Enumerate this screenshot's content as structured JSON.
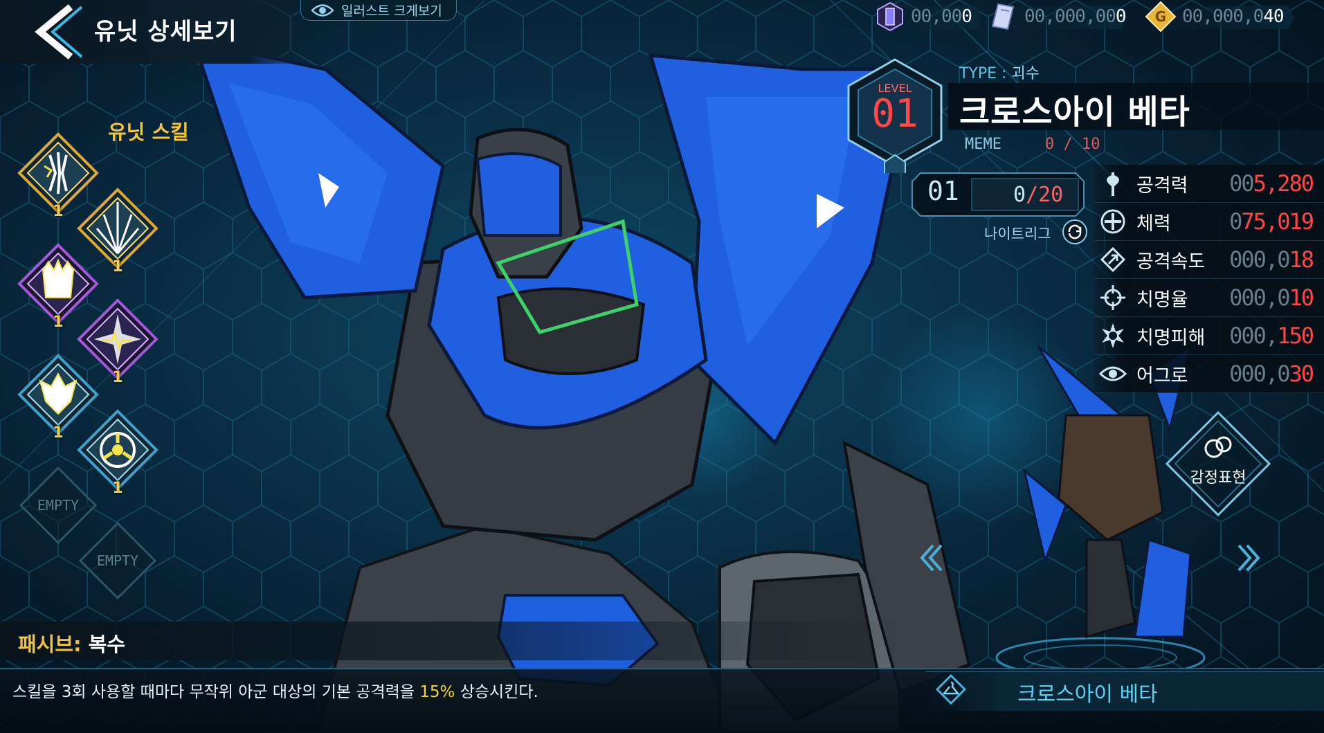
{
  "header": {
    "title": "유닛 상세보기",
    "illust_button": "일러스트 크게보기"
  },
  "currencies": [
    {
      "icon": "gem-crystal-icon",
      "dim": "00,00",
      "value": "0"
    },
    {
      "icon": "ticket-icon",
      "dim": "00,000,00",
      "value": "0"
    },
    {
      "icon": "gold-coin-icon",
      "dim": "00,000,0",
      "value": "40"
    }
  ],
  "skills": {
    "title": "유닛 스킬",
    "items": [
      {
        "icon": "lightning-claw-icon",
        "level": "1"
      },
      {
        "icon": "spike-burst-icon",
        "level": "1"
      },
      {
        "icon": "crowned-beast-icon",
        "level": "1"
      },
      {
        "icon": "pulse-star-icon",
        "level": "1"
      },
      {
        "icon": "dragon-head-icon",
        "level": "1"
      },
      {
        "icon": "biohazard-icon",
        "level": "1"
      }
    ],
    "empty_slots": [
      "EMPTY",
      "EMPTY"
    ]
  },
  "passive": {
    "label": "패시브:",
    "name": "복수",
    "desc_before": "스킬을 3회 사용할 때마다 무작위 아군 대상의 기본 공격력을 ",
    "desc_highlight": "15%",
    "desc_after": " 상승시킨다."
  },
  "unit": {
    "type_label": "TYPE :",
    "type_value": "괴수",
    "name": "크로스아이 베타",
    "level_label": "LEVEL",
    "level": "01",
    "meme_label": "MEME",
    "meme_current": "0",
    "meme_max": "10",
    "league_rank": "01",
    "league_current": "0",
    "league_max": "20",
    "league_name": "나이트리그"
  },
  "stats": [
    {
      "icon": "axe-icon",
      "label": "공격력",
      "dim": "00",
      "value": "5,280"
    },
    {
      "icon": "shield-cross-icon",
      "label": "체력",
      "dim": "0",
      "value": "75,019"
    },
    {
      "icon": "speed-arrow-icon",
      "label": "공격속도",
      "dim": "000,0",
      "value": "18"
    },
    {
      "icon": "crosshair-icon",
      "label": "치명율",
      "dim": "000,0",
      "value": "10"
    },
    {
      "icon": "burst-icon",
      "label": "치명피해",
      "dim": "000,",
      "value": "150"
    },
    {
      "icon": "eye-icon",
      "label": "어그로",
      "dim": "000,0",
      "value": "30"
    }
  ],
  "emote": {
    "label": "감정표현"
  },
  "bottom_name": "크로스아이 베타",
  "colors": {
    "accent_gold": "#f2c53c",
    "stat_red": "#ff4646",
    "cyan": "#5fd0f0",
    "mech_blue": "#1f5fe0"
  }
}
